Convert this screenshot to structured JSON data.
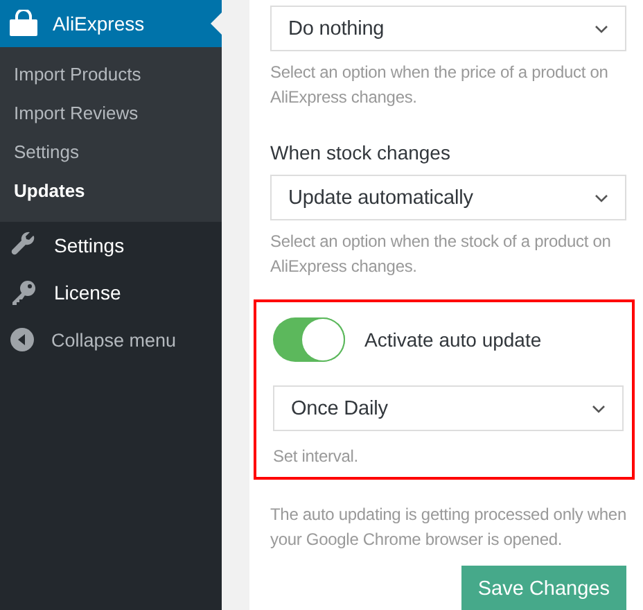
{
  "sidebar": {
    "menu": {
      "label": "AliExpress",
      "selected": true
    },
    "submenu": [
      {
        "label": "Import Products",
        "selected": false
      },
      {
        "label": "Import Reviews",
        "selected": false
      },
      {
        "label": "Settings",
        "selected": false
      },
      {
        "label": "Updates",
        "selected": true
      }
    ],
    "items": [
      {
        "label": "Settings",
        "kind": "wrench"
      },
      {
        "label": "License",
        "kind": "key"
      },
      {
        "label": "Collapse menu",
        "kind": "collapse"
      }
    ]
  },
  "price_select": {
    "value": "Do nothing",
    "hint": "Select an option when the price of a product on AliExpress changes."
  },
  "stock": {
    "label": "When stock changes",
    "select": {
      "value": "Update automatically"
    },
    "hint": "Select an option when the stock of a product on AliExpress changes."
  },
  "auto_update": {
    "highlighted": true,
    "on": true,
    "label": "Activate auto update",
    "select": {
      "value": "Once Daily"
    },
    "hint": "Set interval."
  },
  "note": "The auto updating is getting processed only when your Google Chrome browser is opened.",
  "save_button": "Save Changes"
}
